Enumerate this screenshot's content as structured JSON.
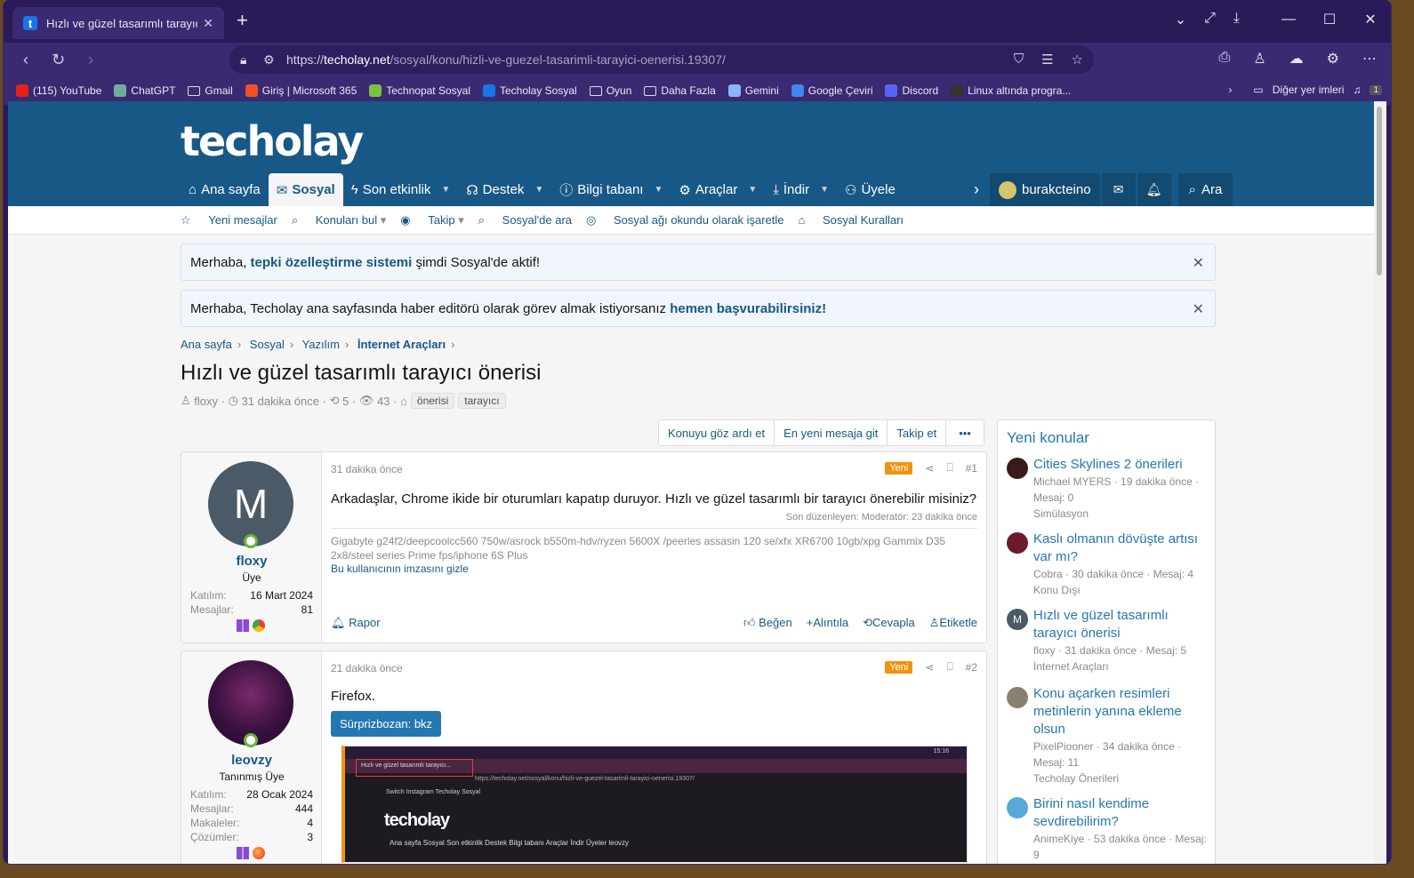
{
  "browser": {
    "tab_title": "Hızlı ve güzel tasarımlı tarayıcı ön",
    "url_prefix": "https://",
    "url_host": "techolay.net",
    "url_path": "/sosyal/konu/hizli-ve-guezel-tasarimli-tarayici-oenerisi.19307/",
    "bookmarks": [
      {
        "label": "(115) YouTube",
        "icon": "youtube-icon",
        "color": "#e62117"
      },
      {
        "label": "ChatGPT",
        "icon": "chatgpt-icon",
        "color": "#74aa9c"
      },
      {
        "label": "Gmail",
        "icon": "folder-icon",
        "color": ""
      },
      {
        "label": "Giriş | Microsoft 365",
        "icon": "microsoft-icon",
        "color": "#f25022"
      },
      {
        "label": "Technopat Sosyal",
        "icon": "power-icon",
        "color": "#7ac142"
      },
      {
        "label": "Techolay Sosyal",
        "icon": "techolay-icon",
        "color": "#1a73e8"
      },
      {
        "label": "Oyun",
        "icon": "folder-icon",
        "color": ""
      },
      {
        "label": "Daha Fazla",
        "icon": "folder-icon",
        "color": ""
      },
      {
        "label": "Gemini",
        "icon": "gemini-icon",
        "color": "#8ab4f8"
      },
      {
        "label": "Google Çeviri",
        "icon": "translate-icon",
        "color": "#4285f4"
      },
      {
        "label": "Discord",
        "icon": "discord-icon",
        "color": "#5865f2"
      },
      {
        "label": "Linux altında progra...",
        "icon": "linux-icon",
        "color": "#333333"
      }
    ],
    "other_bookmarks": "Diğer yer imleri",
    "badge_count": "1"
  },
  "site": {
    "logo": "techolay",
    "nav": [
      {
        "label": "Ana sayfa",
        "icon": "home-icon"
      },
      {
        "label": "Sosyal",
        "icon": "comments-icon",
        "active": true
      },
      {
        "label": "Son etkinlik",
        "icon": "bolt-icon"
      },
      {
        "label": "Destek",
        "icon": "support-icon"
      },
      {
        "label": "Bilgi tabanı",
        "icon": "info-icon"
      },
      {
        "label": "Araçlar",
        "icon": "gear-icon"
      },
      {
        "label": "İndir",
        "icon": "download-icon"
      },
      {
        "label": "Üyele",
        "icon": "users-icon"
      }
    ],
    "username": "burakcteino",
    "search_label": "Ara",
    "subnav": [
      "Yeni mesajlar",
      "Konuları bul",
      "Takip",
      "Sosyal'de ara",
      "Sosyal ağı okundu olarak işaretle",
      "Sosyal Kuralları"
    ],
    "notices": [
      {
        "pre": "Merhaba, ",
        "link": "tepki özelleştirme sistemi",
        "post": " şimdi Sosyal'de aktif!"
      },
      {
        "pre": "Merhaba, Techolay ana sayfasında haber editörü olarak görev almak istiyorsanız ",
        "link": "hemen başvurabilirsiniz!",
        "post": ""
      }
    ]
  },
  "thread": {
    "breadcrumb": [
      "Ana sayfa",
      "Sosyal",
      "Yazılım",
      "İnternet Araçları"
    ],
    "title": "Hızlı ve güzel tasarımlı tarayıcı önerisi",
    "author": "floxy",
    "time": "31 dakika önce",
    "replies": "5",
    "views": "43",
    "tags": [
      "önerisi",
      "tarayıcı"
    ],
    "actions": [
      "Konuyu göz ardı et",
      "En yeni mesaja git",
      "Takip et",
      "•••"
    ]
  },
  "posts": [
    {
      "avatar_letter": "M",
      "user": "floxy",
      "role": "Üye",
      "joined_label": "Katılım:",
      "joined": "16 Mart 2024",
      "messages_label": "Mesajlar:",
      "messages": "81",
      "time": "31 dakika önce",
      "new_badge": "Yeni",
      "number": "#1",
      "text": "Arkadaşlar, Chrome ikide bir oturumları kapatıp duruyor. Hızlı ve güzel tasarımlı bir tarayıcı önerebilir misiniz?",
      "edited": "Son düzenleyen: Moderatör: 23 dakika önce",
      "signature": "Gigabyte g24f2/deepcoolcc560 750w/asrock b550m-hdv/ryzen 5600X /peerles assasin 120 se/xfx XR6700 10gb/xpg Gammix D35 2x8/steel series Prime fps/iphone 6S Plus",
      "signature_toggle": "Bu kullanıcının imzasını gizle",
      "report": "Rapor",
      "footer": [
        "Beğen",
        "Alıntıla",
        "Cevapla",
        "Etiketle"
      ]
    },
    {
      "user": "leovzy",
      "role": "Tanınmış Üye",
      "joined_label": "Katılım:",
      "joined": "28 Ocak 2024",
      "messages_label": "Mesajlar:",
      "messages": "444",
      "articles_label": "Makaleler:",
      "articles": "4",
      "solutions_label": "Çözümler:",
      "solutions": "3",
      "time": "21 dakika önce",
      "new_badge": "Yeni",
      "number": "#2",
      "text": "Firefox.",
      "spoiler": "Sürprizbozan: bkz",
      "screenshot": {
        "tab": "Hızlı ve güzel tasarımlı tarayıcı...",
        "url": "https://techolay.net/sosyal/konu/hizli-ve-guezel-tasarimli-tarayici-oenerisi.19307/",
        "bookmarks": "Switch   Instagram   Techolay Sosyal",
        "logo": "techolay",
        "nav": "Ana sayfa   Sosyal   Son etkinlik   Destek   Bilgi tabanı   Araçlar   İndir   Üyeler     leovzy",
        "clock": "15:16"
      }
    }
  ],
  "sidebar": {
    "title": "Yeni konular",
    "items": [
      {
        "title": "Cities Skylines 2 önerileri",
        "meta": "Michael MYERS · 19 dakika önce · Mesaj: 0",
        "forum": "Simülasyon",
        "avatar_color": "#3a1a1a"
      },
      {
        "title": "Kaslı olmanın dövüşte artısı var mı?",
        "meta": "Cobra · 30 dakika önce · Mesaj: 4",
        "forum": "Konu Dışı",
        "avatar_color": "#6a1a2a"
      },
      {
        "title": "Hızlı ve güzel tasarımlı tarayıcı önerisi",
        "meta": "floxy · 31 dakika önce · Mesaj: 5",
        "forum": "İnternet Araçları",
        "avatar_color": "#4a5a66",
        "avatar_letter": "M"
      },
      {
        "title": "Konu açarken resimleri metinlerin yanına ekleme olsun",
        "meta": "PixelPiooner · 34 dakika önce · Mesaj: 11",
        "forum": "Techolay Önerileri",
        "avatar_color": "#8a8070"
      },
      {
        "title": "Birini nasıl kendime sevdirebilirim?",
        "meta": "AnimeKiye · 53 dakika önce · Mesaj: 9",
        "forum": "",
        "avatar_color": "#58a8d8"
      }
    ]
  }
}
